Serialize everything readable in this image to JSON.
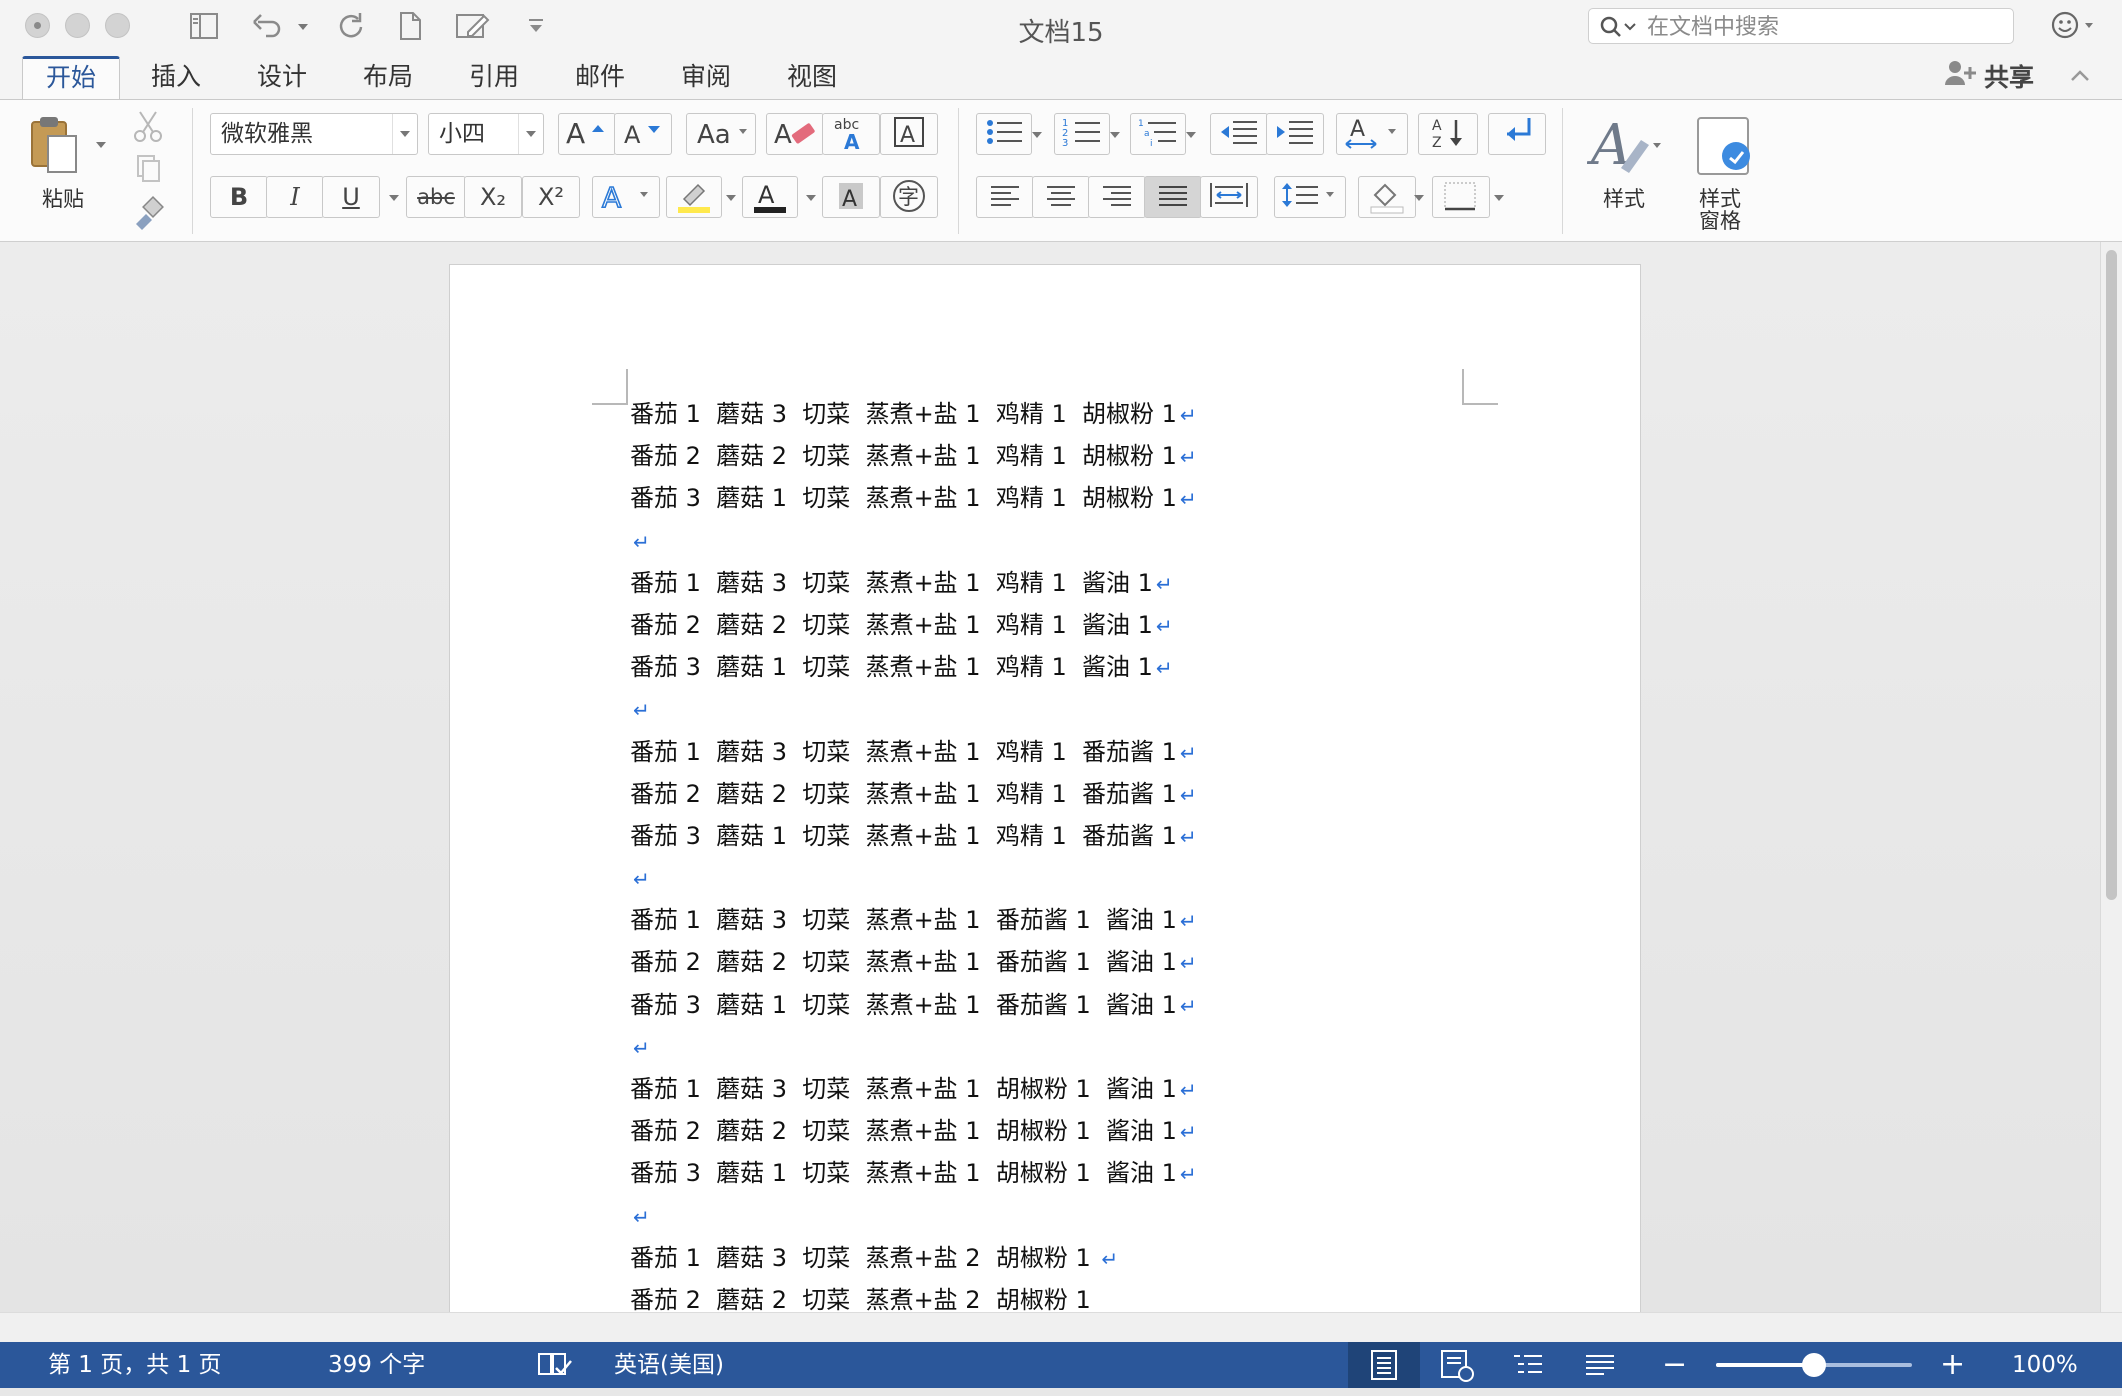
{
  "window": {
    "title": "文档15"
  },
  "search": {
    "placeholder": "在文档中搜索"
  },
  "tabs": [
    {
      "label": "开始",
      "active": true
    },
    {
      "label": "插入"
    },
    {
      "label": "设计"
    },
    {
      "label": "布局"
    },
    {
      "label": "引用"
    },
    {
      "label": "邮件"
    },
    {
      "label": "审阅"
    },
    {
      "label": "视图"
    }
  ],
  "share_label": "共享",
  "ribbon": {
    "paste_label": "粘贴",
    "font_name": "微软雅黑",
    "font_size": "小四",
    "bold": "B",
    "italic": "I",
    "underline": "U",
    "strike": "abc",
    "subscript": "X₂",
    "superscript": "X²",
    "spell_abc": "abc",
    "char_border": "A",
    "char_shading": "A",
    "enclose_char": "字",
    "styles_label": "样式",
    "styles_pane_label": "样式\n窗格"
  },
  "document": {
    "lines": [
      "番茄 1  蘑菇 3  切菜  蒸煮+盐 1  鸡精 1  胡椒粉 1",
      "番茄 2  蘑菇 2  切菜  蒸煮+盐 1  鸡精 1  胡椒粉 1",
      "番茄 3  蘑菇 1  切菜  蒸煮+盐 1  鸡精 1  胡椒粉 1",
      "",
      "番茄 1  蘑菇 3  切菜  蒸煮+盐 1  鸡精 1  酱油 1",
      "番茄 2  蘑菇 2  切菜  蒸煮+盐 1  鸡精 1  酱油 1",
      "番茄 3  蘑菇 1  切菜  蒸煮+盐 1  鸡精 1  酱油 1",
      "",
      "番茄 1  蘑菇 3  切菜  蒸煮+盐 1  鸡精 1  番茄酱 1",
      "番茄 2  蘑菇 2  切菜  蒸煮+盐 1  鸡精 1  番茄酱 1",
      "番茄 3  蘑菇 1  切菜  蒸煮+盐 1  鸡精 1  番茄酱 1",
      "",
      "番茄 1  蘑菇 3  切菜  蒸煮+盐 1  番茄酱 1  酱油 1",
      "番茄 2  蘑菇 2  切菜  蒸煮+盐 1  番茄酱 1  酱油 1",
      "番茄 3  蘑菇 1  切菜  蒸煮+盐 1  番茄酱 1  酱油 1",
      "",
      "番茄 1  蘑菇 3  切菜  蒸煮+盐 1  胡椒粉 1  酱油 1",
      "番茄 2  蘑菇 2  切菜  蒸煮+盐 1  胡椒粉 1  酱油 1",
      "番茄 3  蘑菇 1  切菜  蒸煮+盐 1  胡椒粉 1  酱油 1",
      "",
      "番茄 1  蘑菇 3  切菜  蒸煮+盐 2  胡椒粉 1 ",
      "番茄 2  蘑菇 2  切菜  蒸煮+盐 2  胡椒粉 1"
    ],
    "paragraph_mark": "↵"
  },
  "status": {
    "page": "第 1 页，共 1 页",
    "words": "399 个字",
    "language": "英语(美国)",
    "zoom": "100%",
    "zoom_slider_fraction": 0.5
  },
  "colors": {
    "accent": "#2b579a"
  }
}
